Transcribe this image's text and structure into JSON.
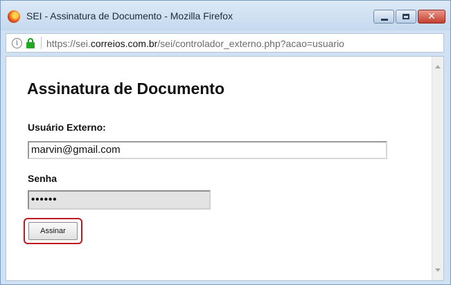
{
  "window": {
    "title": "SEI - Assinatura de Documento - Mozilla Firefox",
    "buttons": {
      "minimize": "minimize",
      "maximize": "maximize",
      "close": "✕"
    }
  },
  "urlbar": {
    "prefix": "https://sei.",
    "domain": "correios.com.br",
    "path": "/sei/controlador_externo.php?acao=usuario"
  },
  "page": {
    "title": "Assinatura de Documento",
    "user_label": "Usuário Externo:",
    "user_value": "marvin@gmail.com",
    "password_label": "Senha",
    "password_value": "••••••",
    "submit_label": "Assinar"
  },
  "colors": {
    "highlight": "#c0181e",
    "lock": "#22a922"
  },
  "icons": [
    "firefox-icon",
    "info-icon",
    "lock-icon",
    "scroll-up-icon",
    "scroll-down-icon"
  ]
}
